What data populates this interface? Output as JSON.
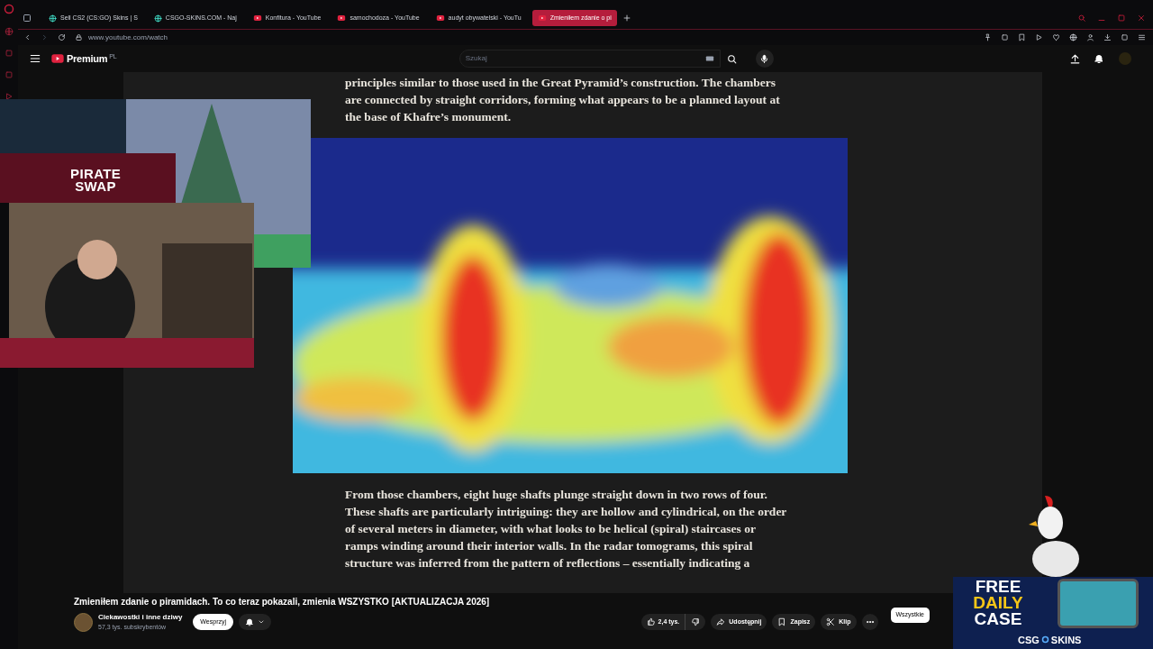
{
  "browser": {
    "tabs": [
      {
        "title": "Sell CS2 (CS:GO) Skins | S",
        "kind": "site",
        "selected": false
      },
      {
        "title": "CSGO-SKINS.COM - Naj",
        "kind": "site",
        "selected": false
      },
      {
        "title": "Konfitura - YouTube",
        "kind": "youtube",
        "selected": false
      },
      {
        "title": "samochodoza - YouTube",
        "kind": "youtube",
        "selected": false
      },
      {
        "title": "audyt obywatelski - YouTu",
        "kind": "youtube",
        "selected": false
      },
      {
        "title": "Zmieniłem zdanie o pi",
        "kind": "youtube",
        "selected": true
      }
    ],
    "url": "www.youtube.com/watch"
  },
  "header": {
    "logo_text": "Premium",
    "region": "PL",
    "search": {
      "placeholder": "Szukaj"
    }
  },
  "article": {
    "paragraphs_before": [
      "principles similar to those used in the Great Pyramid’s construction. The chambers are connected by straight corridors, forming what appears to be a planned layout at the base of Khafre’s monument."
    ],
    "paragraphs_after": [
      "From those chambers, eight huge shafts plunge straight down in two rows of four. These shafts are particularly intriguing: they are hollow and cylindrical, on the order of several meters in diameter, with what looks to be helical (spiral) staircases or ramps winding around their interior walls. In the radar tomograms, this spiral structure was inferred from the pattern of reflections – essentially indicating a"
    ]
  },
  "video": {
    "title": "Zmieniłem zdanie o piramidach. To co teraz pokazali, zmienia WSZYSTKO [AKTUALIZACJA 2026]",
    "channel": {
      "name": "Ciekawostki i inne dziwy",
      "subscribers": "57,3 tys. subskrybentów"
    },
    "support_button": "Wesprzyj",
    "likes": "2,4 tys.",
    "actions": [
      {
        "label": "Udostępnij",
        "kind": "share"
      },
      {
        "label": "Zapisz",
        "kind": "save"
      },
      {
        "label": "Klip",
        "kind": "clip"
      }
    ],
    "chips": [
      {
        "label": "Wszystkie",
        "selected": true
      }
    ]
  },
  "overlays": {
    "webcam_logo": [
      "PIRATE",
      "SWAP"
    ],
    "ad": {
      "lines": [
        "FREE",
        "DAILY",
        "CASE"
      ],
      "brand": [
        "CSG",
        "SKINS"
      ]
    }
  }
}
